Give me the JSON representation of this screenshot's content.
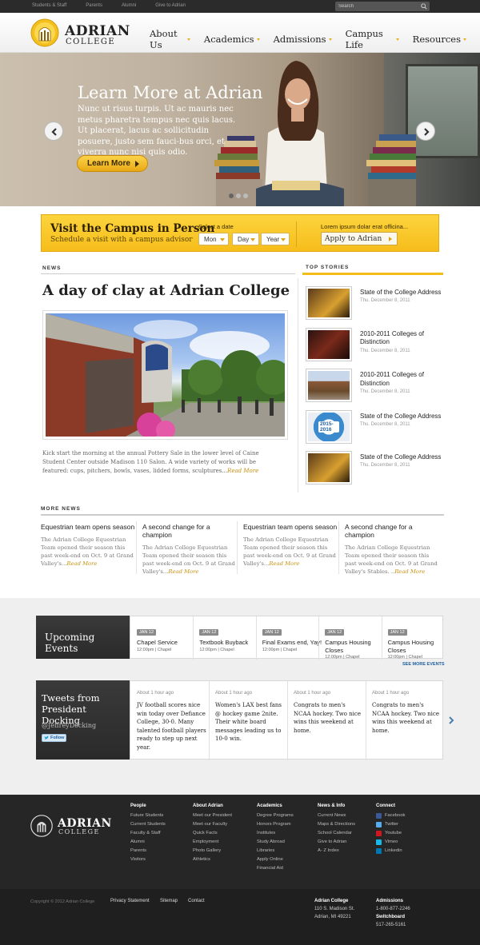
{
  "topbar": {
    "links": [
      "Students & Staff",
      "Parents",
      "Alumni",
      "Give to Adrian"
    ],
    "search_placeholder": "Search"
  },
  "logo": {
    "line1": "ADRIAN",
    "line2": "COLLEGE"
  },
  "nav": [
    "About Us",
    "Academics",
    "Admissions",
    "Campus Life",
    "Resources"
  ],
  "hero": {
    "title": "Learn More at Adrian",
    "body": "Nunc ut risus turpis. Ut ac mauris nec metus pharetra tempus nec quis lacus. Ut placerat, lacus ac sollicitudin posuere, justo sem fauci-bus orci, et viverra nunc nisi quis odio.",
    "button": "Learn More",
    "slides": 3,
    "active_slide": 1
  },
  "visit": {
    "title": "Visit the Campus in Person",
    "subtitle": "Schedule a visit with a campus advisor",
    "select_label": "Select a date",
    "month": "Mon",
    "day": "Day",
    "year": "Year",
    "lorem": "Lorem ipsum dolar erat officina...",
    "apply": "Apply to Adrian"
  },
  "news": {
    "label": "NEWS",
    "headline": "A day of clay at Adrian College",
    "body": "Kick start the morning at the annual Pottery Sale in the lower level of Caine Student Center outside Madison 110 Salon. A wide variety of works will be featured: cups, pitchers, bowls, vases, lidded forms, sculptures...",
    "read_more": "Read More"
  },
  "top_stories": {
    "label": "TOP STORIES",
    "items": [
      {
        "title": "State of the College Address",
        "date": "Thu. December 8, 2011"
      },
      {
        "title": "2010-2011 Colleges of Distinction",
        "date": "Thu. December 8, 2011"
      },
      {
        "title": "2010-2011 Colleges of Distinction",
        "date": "Thu. December 8, 2011"
      },
      {
        "title": "State of the College Address",
        "date": "Thu. December 8, 2011",
        "badge": "2015-2016"
      },
      {
        "title": "State of the College Address",
        "date": "Thu. December 8, 2011"
      }
    ]
  },
  "more_news": {
    "label": "MORE NEWS",
    "items": [
      {
        "title": "Equestrian team opens season",
        "body": "The Adrian College Equestrian Team opened their season this past week-end on Oct. 9 at Grand Valley's...",
        "more": "Read More"
      },
      {
        "title": "A second change for a champion",
        "body": "The Adrian College Equestrian Team opened their season this past week-end on Oct. 9 at Grand Valley's...",
        "more": "Read More"
      },
      {
        "title": "Equestrian team opens season",
        "body": "The Adrian College Equestrian Team opened their season this past week-end on Oct. 9 at Grand Valley's...",
        "more": "Read More"
      },
      {
        "title": "A second change for a champion",
        "body": "The Adrian College Equestrian Team opened their season this past week-end on Oct. 9 at Grand Valley's Stables. ..",
        "more": "Read More"
      }
    ]
  },
  "events": {
    "title": "Upcoming Events",
    "see_more": "SEE MORE EVENTS",
    "items": [
      {
        "tag": "JAN 12",
        "title": "Chapel Service",
        "sub": "12:00pm | Chapel"
      },
      {
        "tag": "JAN 12",
        "title": "Textbook Buyback",
        "sub": "12:00pm | Chapel"
      },
      {
        "tag": "JAN 12",
        "title": "Final Exams end, Yay!",
        "sub": "12:00pm | Chapel"
      },
      {
        "tag": "JAN 12",
        "title": "Campus Housing Closes",
        "sub": "12:00pm | Chapel"
      },
      {
        "tag": "JAN 12",
        "title": "Campus Housing Closes",
        "sub": "12:00pm | Chapel"
      }
    ]
  },
  "tweets": {
    "title": "Tweets from President Docking",
    "handle": "@JeffreyDocking",
    "follow": "Follow",
    "items": [
      {
        "ago": "About 1 hour ago",
        "text": "JV football scores nice win today over Defiance College, 30-0. Many talented football players ready to step up next year."
      },
      {
        "ago": "About 1 hour ago",
        "text": "Women's LAX best fans @ hockey game 2nite. Their white board messages leading us to 10-0 win."
      },
      {
        "ago": "About 1 hour ago",
        "text": "Congrats to men's NCAA hockey. Two nice wins this weekend at home."
      },
      {
        "ago": "About 1 hour ago",
        "text": "Congrats to men's NCAA hockey. Two nice wins this weekend at home."
      }
    ]
  },
  "footer": {
    "columns": [
      {
        "heading": "People",
        "links": [
          "Future Students",
          "Current Students",
          "Faculty & Staff",
          "Alumni",
          "Parents",
          "Visitors"
        ]
      },
      {
        "heading": "About Adrian",
        "links": [
          "Meet our President",
          "Meet our Faculty",
          "Quick Facts",
          "Employment",
          "Photo Gallery",
          "Athletics"
        ]
      },
      {
        "heading": "Academics",
        "links": [
          "Degree Programs",
          "Honors Program",
          "Institutes",
          "Study Abroad",
          "Libraries",
          "Apply Online",
          "Financial Aid"
        ]
      },
      {
        "heading": "News & Info",
        "links": [
          "Current News",
          "Maps & Directions",
          "School Calendar",
          "Give to Adrian",
          "A- Z Index"
        ]
      },
      {
        "heading": "Connect",
        "links": [
          "Facebook",
          "Twitter",
          "Youtube",
          "Vimeo",
          "Linkedin"
        ]
      }
    ],
    "social_colors": [
      "#3b5998",
      "#55acee",
      "#cc181e",
      "#1ab7ea",
      "#0077b5"
    ]
  },
  "bottom": {
    "copyright": "Copyright © 2012 Adrian College",
    "links": [
      "Privacy Statement",
      "Sitemap",
      "Contact"
    ],
    "address_name": "Adrian College",
    "address_1": "110 S. Madison St.",
    "address_2": "Adrian, MI 49221",
    "admissions_label": "Admissions",
    "admissions_phone": "1-800-877-2246",
    "switchboard_label": "Switchboard",
    "switchboard_phone": "517-265-5161"
  }
}
